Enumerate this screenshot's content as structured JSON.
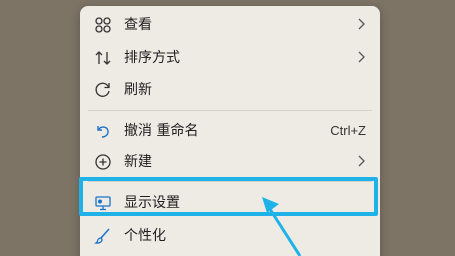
{
  "menu": {
    "items": [
      {
        "label": "查看",
        "icon": "grid-icon",
        "submenu": true
      },
      {
        "label": "排序方式",
        "icon": "sort-icon",
        "submenu": true
      },
      {
        "label": "刷新",
        "icon": "refresh-icon",
        "submenu": false
      },
      {
        "label": "撤消 重命名",
        "icon": "undo-icon",
        "shortcut": "Ctrl+Z"
      },
      {
        "label": "新建",
        "icon": "plus-circle-icon",
        "submenu": true
      },
      {
        "label": "显示设置",
        "icon": "display-settings-icon",
        "submenu": false,
        "highlighted": true
      },
      {
        "label": "个性化",
        "icon": "brush-icon",
        "submenu": false
      }
    ]
  },
  "colors": {
    "desktop": "#7d7466",
    "menu_bg": "#eeebe5",
    "highlight": "#1fb2e8",
    "accent_icon": "#1a73c8"
  }
}
